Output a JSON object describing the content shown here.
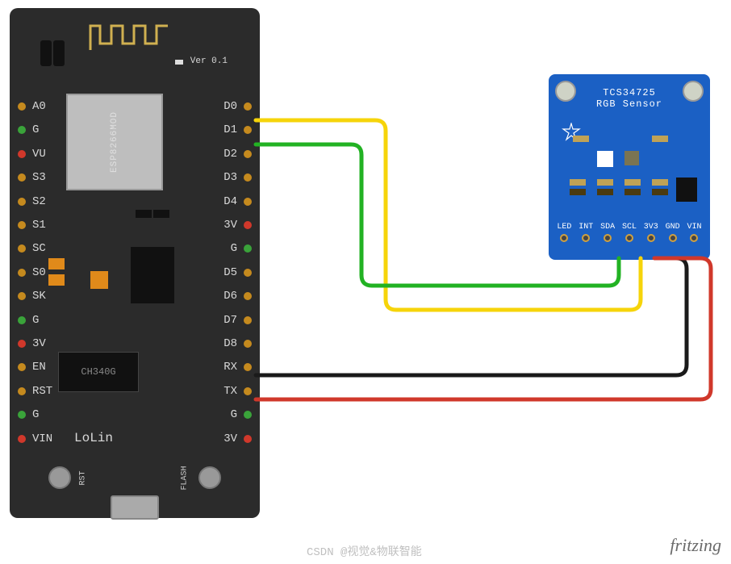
{
  "nodemcu": {
    "version_label": "Ver 0.1",
    "logo": "LoLin",
    "main_chip_label": "ESP8266MOD",
    "usb_chip_label": "CH340G",
    "buttons": {
      "rst": "RST",
      "flash": "FLASH"
    },
    "pins_left": [
      "A0",
      "G",
      "VU",
      "S3",
      "S2",
      "S1",
      "SC",
      "S0",
      "SK",
      "G",
      "3V",
      "EN",
      "RST",
      "G",
      "VIN"
    ],
    "pins_right": [
      "D0",
      "D1",
      "D2",
      "D3",
      "D4",
      "3V",
      "G",
      "D5",
      "D6",
      "D7",
      "D8",
      "RX",
      "TX",
      "G",
      "3V"
    ],
    "pin_dot_color_left": [
      "orange",
      "green",
      "red",
      "orange",
      "orange",
      "orange",
      "orange",
      "orange",
      "orange",
      "green",
      "red",
      "orange",
      "orange",
      "green",
      "red"
    ],
    "pin_dot_color_right": [
      "orange",
      "orange",
      "orange",
      "orange",
      "orange",
      "red",
      "green",
      "orange",
      "orange",
      "orange",
      "orange",
      "orange",
      "orange",
      "green",
      "red"
    ]
  },
  "sensor": {
    "title": "TCS34725",
    "subtitle": "RGB Sensor",
    "pins": [
      "LED",
      "INT",
      "SDA",
      "SCL",
      "3V3",
      "GND",
      "VIN"
    ]
  },
  "wires": {
    "scl": {
      "color": "#f6d40a",
      "from": "nodemcu.D1",
      "to": "sensor.SCL"
    },
    "sda": {
      "color": "#22b223",
      "from": "nodemcu.D2",
      "to": "sensor.SDA"
    },
    "gnd": {
      "color": "#1a1a1a",
      "from": "nodemcu.G",
      "to": "sensor.GND"
    },
    "vcc": {
      "color": "#d0382b",
      "from": "nodemcu.3V",
      "to": "sensor.3V3"
    }
  },
  "footer": {
    "software": "fritzing",
    "watermark": "CSDN @视觉&物联智能"
  }
}
